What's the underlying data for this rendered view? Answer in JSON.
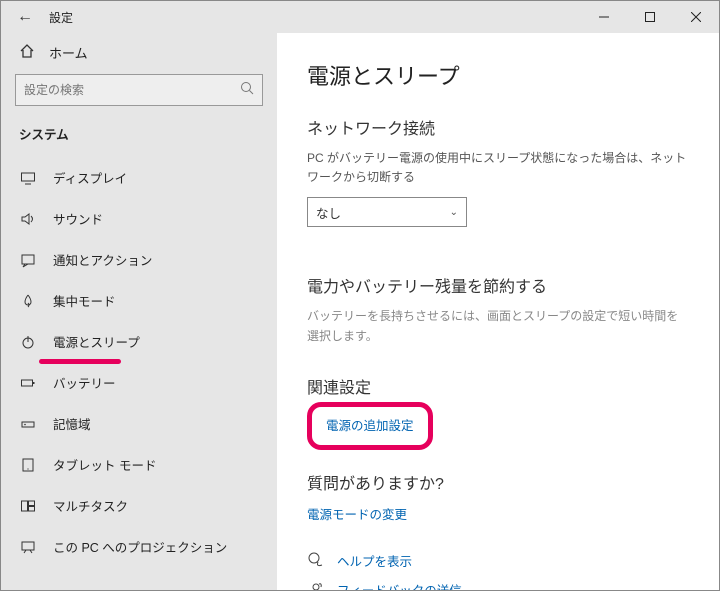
{
  "titlebar": {
    "title": "設定"
  },
  "sidebar": {
    "home": "ホーム",
    "search_placeholder": "設定の検索",
    "section": "システム",
    "items": [
      {
        "label": "ディスプレイ"
      },
      {
        "label": "サウンド"
      },
      {
        "label": "通知とアクション"
      },
      {
        "label": "集中モード"
      },
      {
        "label": "電源とスリープ"
      },
      {
        "label": "バッテリー"
      },
      {
        "label": "記憶域"
      },
      {
        "label": "タブレット モード"
      },
      {
        "label": "マルチタスク"
      },
      {
        "label": "この PC へのプロジェクション"
      }
    ]
  },
  "content": {
    "h1": "電源とスリープ",
    "net_h2": "ネットワーク接続",
    "net_desc": "PC がバッテリー電源の使用中にスリープ状態になった場合は、ネットワークから切断する",
    "net_select": "なし",
    "save_h2": "電力やバッテリー残量を節約する",
    "save_desc": "バッテリーを長持ちさせるには、画面とスリープの設定で短い時間を選択します。",
    "related_h2": "関連設定",
    "related_link": "電源の追加設定",
    "faq_h2": "質問がありますか?",
    "faq_link": "電源モードの変更",
    "help_link": "ヘルプを表示",
    "feedback_link": "フィードバックの送信"
  }
}
